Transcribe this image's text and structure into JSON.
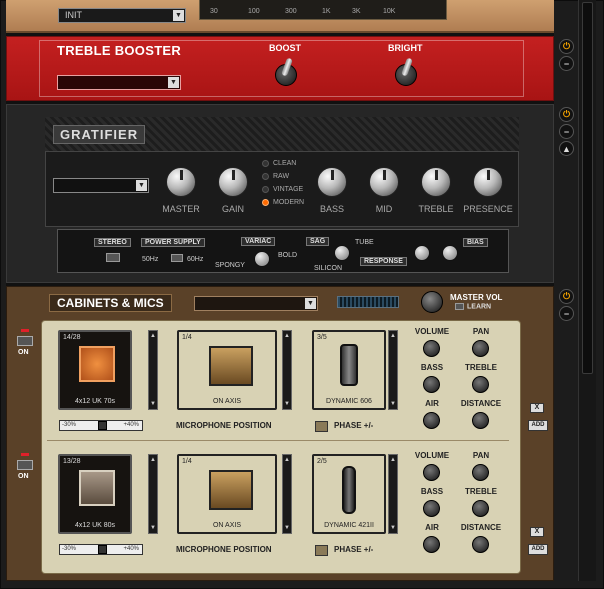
{
  "eq": {
    "preset": "INIT",
    "freq_labels": [
      "30",
      "100",
      "300",
      "1K",
      "3K",
      "10K"
    ]
  },
  "treble_booster": {
    "title": "TREBLE BOOSTER",
    "switch_boost": "BOOST",
    "switch_bright": "BRIGHT"
  },
  "gratifier": {
    "title": "GRATIFIER",
    "knobs": [
      "MASTER",
      "GAIN",
      "BASS",
      "MID",
      "TREBLE",
      "PRESENCE"
    ],
    "modes": [
      "CLEAN",
      "RAW",
      "VINTAGE",
      "MODERN"
    ],
    "active_mode": "MODERN",
    "stereo": "STEREO",
    "power_supply": "POWER SUPPLY",
    "hz50": "50Hz",
    "hz60": "60Hz",
    "variac": "VARIAC",
    "spongy": "SPONGY",
    "bold": "BOLD",
    "sag": "SAG",
    "tube": "TUBE",
    "silicon": "SILICON",
    "response": "RESPONSE",
    "bias": "BIAS"
  },
  "cabinets": {
    "title": "CABINETS & MICS",
    "master_vol": "MASTER VOL",
    "learn": "LEARN",
    "on": "ON",
    "mic_position": "MICROPHONE POSITION",
    "phase": "PHASE +/-",
    "x": "X",
    "add": "ADD",
    "knob_labels": [
      "VOLUME",
      "PAN",
      "BASS",
      "TREBLE",
      "AIR",
      "DISTANCE"
    ],
    "slots": [
      {
        "cab_counter": "14/28",
        "cab_name": "4x12 UK 70s",
        "pos_counter": "1/4",
        "pos_name": "ON AXIS",
        "mic_counter": "3/5",
        "mic_name": "DYNAMIC 606",
        "pos_left": "-30%",
        "pos_right": "+40%"
      },
      {
        "cab_counter": "13/28",
        "cab_name": "4x12 UK 80s",
        "pos_counter": "1/4",
        "pos_name": "ON AXIS",
        "mic_counter": "2/5",
        "mic_name": "DYNAMIC 421II",
        "pos_left": "-30%",
        "pos_right": "+40%"
      }
    ]
  }
}
